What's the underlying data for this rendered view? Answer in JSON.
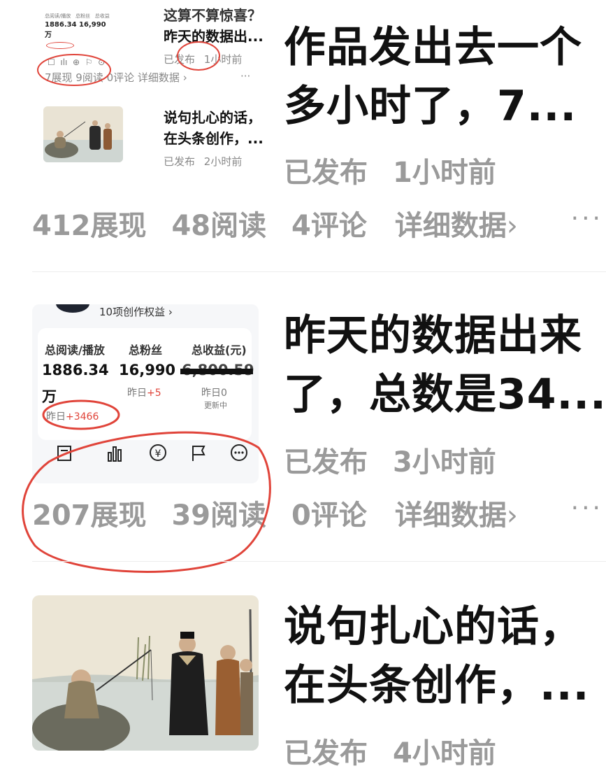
{
  "items": [
    {
      "title_lines": [
        "作品发出去一个",
        "多小时了，7..."
      ],
      "status": "已发布",
      "time": "1小时前",
      "stats": [
        "412展现",
        "48阅读",
        "4评论"
      ],
      "detail_label": "详细数据",
      "more": "···",
      "mini": {
        "top_title": "这算不算惊喜？",
        "item1_title": "昨天的数据出...",
        "item1_status": "已发布",
        "item1_time": "1小时前",
        "item1_stats": "7展现  9阅读  0评论  详细数据 ›",
        "item2_title_lines": [
          "说句扎心的话，",
          "在头条创作，..."
        ],
        "item2_status": "已发布",
        "item2_time": "2小时前",
        "dash_values": [
          "1886.34",
          "16,990",
          "万"
        ]
      }
    },
    {
      "title_lines": [
        "昨天的数据出来",
        "了，总数是34..."
      ],
      "status": "已发布",
      "time": "3小时前",
      "stats": [
        "207展现",
        "39阅读",
        "0评论"
      ],
      "detail_label": "详细数据",
      "more": "···",
      "dashboard": {
        "entry_label": "10项创作权益 ›",
        "labels": [
          "总阅读/播放",
          "总粉丝",
          "总收益(元)"
        ],
        "values": [
          "1886.34",
          "16,990",
          "6,800.59"
        ],
        "unit": "万",
        "yesterday_fans_prefix": "昨日",
        "yesterday_fans_delta": "+5",
        "yesterday_income": "昨日0",
        "updating": "更新中",
        "yesterday_reads_prefix": "昨日",
        "yesterday_reads_delta": "+3466"
      }
    },
    {
      "title_lines": [
        "说句扎心的话，",
        "在头条创作，..."
      ],
      "status": "已发布",
      "time": "4小时前"
    }
  ],
  "colors": {
    "annotation_red": "#e0443a",
    "muted_text": "#9a9a9a"
  }
}
